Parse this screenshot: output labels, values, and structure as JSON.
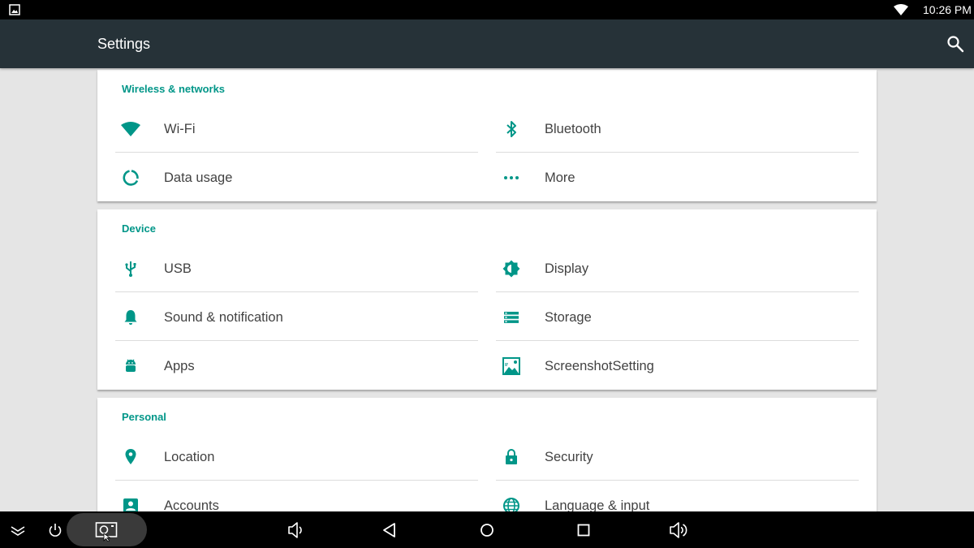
{
  "status_bar": {
    "time": "10:26 PM",
    "left_icon": "image-icon",
    "wifi_icon": "wifi-signal-icon"
  },
  "app_bar": {
    "title": "Settings",
    "search_icon": "search-icon"
  },
  "sections": [
    {
      "category": "Wireless & networks",
      "items": [
        {
          "label": "Wi-Fi",
          "icon": "wifi-icon"
        },
        {
          "label": "Bluetooth",
          "icon": "bluetooth-icon"
        },
        {
          "label": "Data usage",
          "icon": "data-usage-icon"
        },
        {
          "label": "More",
          "icon": "more-icon"
        }
      ]
    },
    {
      "category": "Device",
      "items": [
        {
          "label": "USB",
          "icon": "usb-icon"
        },
        {
          "label": "Display",
          "icon": "display-icon"
        },
        {
          "label": "Sound & notification",
          "icon": "bell-icon"
        },
        {
          "label": "Storage",
          "icon": "storage-icon"
        },
        {
          "label": "Apps",
          "icon": "android-icon"
        },
        {
          "label": "ScreenshotSetting",
          "icon": "screenshot-icon"
        }
      ]
    },
    {
      "category": "Personal",
      "items": [
        {
          "label": "Location",
          "icon": "location-icon"
        },
        {
          "label": "Security",
          "icon": "lock-icon"
        },
        {
          "label": "Accounts",
          "icon": "account-icon"
        },
        {
          "label": "Language & input",
          "icon": "globe-icon"
        }
      ]
    }
  ],
  "nav_bar": {
    "buttons": [
      "collapse-icon",
      "power-icon",
      "screenshot-capture-icon",
      "volume-down-icon",
      "back-icon",
      "home-icon",
      "recents-icon",
      "volume-up-icon"
    ]
  },
  "colors": {
    "accent": "#009688",
    "app_bar": "#263238",
    "background": "#e5e5e5",
    "text": "#424242"
  }
}
